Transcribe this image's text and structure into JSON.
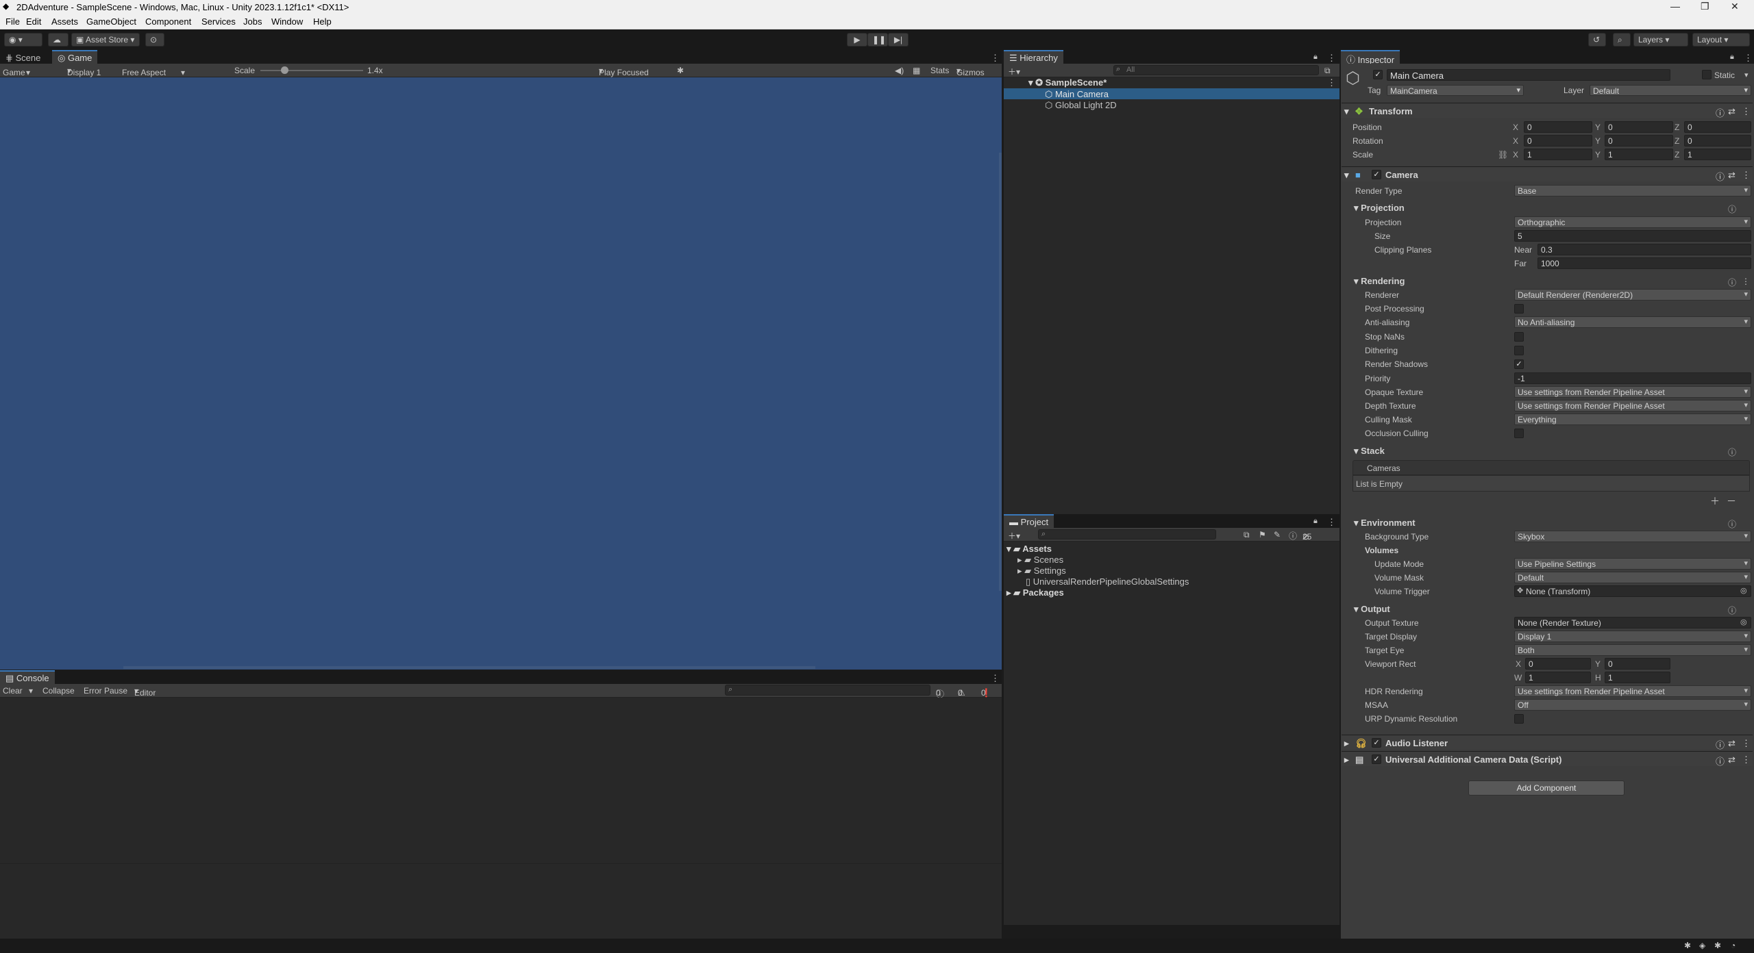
{
  "window": {
    "title": "2DAdventure - SampleScene - Windows, Mac, Linux - Unity 2023.1.12f1c1* <DX11>",
    "min_glyph": "—",
    "max_glyph": "❐",
    "close_glyph": "✕"
  },
  "menu": [
    "File",
    "Edit",
    "Assets",
    "GameObject",
    "Component",
    "Services",
    "Jobs",
    "Window",
    "Help"
  ],
  "toolbar": {
    "asset_store": "Asset Store",
    "layers": "Layers",
    "layout": "Layout"
  },
  "game": {
    "tabs": [
      "Scene",
      "Game"
    ],
    "mode": "Game",
    "display": "Display 1",
    "aspect": "Free Aspect",
    "scale_label": "Scale",
    "scale_value": "1.4x",
    "play_focused": "Play Focused",
    "stats": "Stats",
    "gizmos": "Gizmos",
    "bg_color": "#314d79",
    "scale_fraction": 0.23
  },
  "console": {
    "tab": "Console",
    "clear": "Clear",
    "collapse": "Collapse",
    "error_pause": "Error Pause",
    "editor": "Editor",
    "log_count": "0",
    "warn_count": "0",
    "err_count": "0"
  },
  "hierarchy": {
    "tab": "Hierarchy",
    "search_placeholder": "All",
    "scene": "SampleScene*",
    "items": [
      "Main Camera",
      "Global Light 2D"
    ]
  },
  "project": {
    "tab": "Project",
    "count": "25",
    "assets": "Assets",
    "children": [
      "Scenes",
      "Settings",
      "UniversalRenderPipelineGlobalSettings"
    ],
    "packages": "Packages"
  },
  "inspector": {
    "tab": "Inspector",
    "object_name": "Main Camera",
    "static": "Static",
    "tag_label": "Tag",
    "tag": "MainCamera",
    "layer_label": "Layer",
    "layer": "Default",
    "transform": {
      "title": "Transform",
      "position": "Position",
      "rotation": "Rotation",
      "scale": "Scale",
      "pos": [
        "0",
        "0",
        "0"
      ],
      "rot": [
        "0",
        "0",
        "0"
      ],
      "scl": [
        "1",
        "1",
        "1"
      ]
    },
    "camera": {
      "title": "Camera",
      "render_type_label": "Render Type",
      "render_type": "Base",
      "projection_section": "Projection",
      "projection_label": "Projection",
      "projection": "Orthographic",
      "size_label": "Size",
      "size": "5",
      "clipping_label": "Clipping Planes",
      "near_label": "Near",
      "near": "0.3",
      "far_label": "Far",
      "far": "1000",
      "rendering_section": "Rendering",
      "renderer_label": "Renderer",
      "renderer": "Default Renderer (Renderer2D)",
      "post_processing": "Post Processing",
      "anti_aliasing_label": "Anti-aliasing",
      "anti_aliasing": "No Anti-aliasing",
      "stop_nans": "Stop NaNs",
      "dithering": "Dithering",
      "render_shadows": "Render Shadows",
      "priority_label": "Priority",
      "priority": "-1",
      "opaque_label": "Opaque Texture",
      "opaque": "Use settings from Render Pipeline Asset",
      "depth_label": "Depth Texture",
      "depth": "Use settings from Render Pipeline Asset",
      "culling_label": "Culling Mask",
      "culling": "Everything",
      "occlusion": "Occlusion Culling",
      "stack_section": "Stack",
      "cameras": "Cameras",
      "list_empty": "List is Empty",
      "environment_section": "Environment",
      "bg_type_label": "Background Type",
      "bg_type": "Skybox",
      "volumes": "Volumes",
      "update_mode_label": "Update Mode",
      "update_mode": "Use Pipeline Settings",
      "volume_mask_label": "Volume Mask",
      "volume_mask": "Default",
      "volume_trigger_label": "Volume Trigger",
      "volume_trigger": "None (Transform)",
      "output_section": "Output",
      "output_texture_label": "Output Texture",
      "output_texture": "None (Render Texture)",
      "target_display_label": "Target Display",
      "target_display": "Display 1",
      "target_eye_label": "Target Eye",
      "target_eye": "Both",
      "viewport_label": "Viewport Rect",
      "vx": "0",
      "vy": "0",
      "vw": "1",
      "vh": "1",
      "hdr_label": "HDR Rendering",
      "hdr": "Use settings from Render Pipeline Asset",
      "msaa_label": "MSAA",
      "msaa": "Off",
      "urp_dynamic": "URP Dynamic Resolution"
    },
    "audio_listener": "Audio Listener",
    "uacd": "Universal Additional Camera Data (Script)",
    "add_component": "Add Component"
  }
}
